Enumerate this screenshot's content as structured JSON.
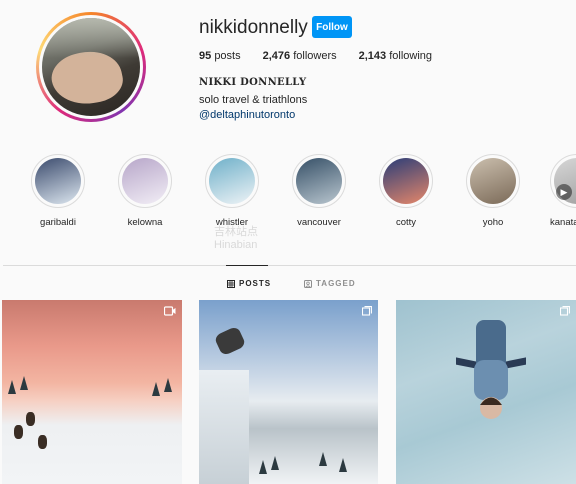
{
  "profile": {
    "username": "nikkidonnelly",
    "follow_label": "Follow",
    "stats": [
      {
        "count": "95",
        "label": "posts"
      },
      {
        "count": "2,476",
        "label": "followers"
      },
      {
        "count": "2,143",
        "label": "following"
      }
    ],
    "display_name": "NIKKI DONNELLY",
    "bio": "solo travel & triathlons",
    "link": "@deltaphinutoronto"
  },
  "highlights": [
    {
      "label": "garibaldi",
      "colors": [
        "#3b4b6d",
        "#dde7f0"
      ]
    },
    {
      "label": "kelowna",
      "colors": [
        "#b7a6c9",
        "#f2eef6"
      ]
    },
    {
      "label": "whistler",
      "colors": [
        "#6fb0c9",
        "#eef3f6"
      ]
    },
    {
      "label": "vancouver",
      "colors": [
        "#365067",
        "#b9c6cf"
      ]
    },
    {
      "label": "cotty",
      "colors": [
        "#2a3d78",
        "#e6876a"
      ]
    },
    {
      "label": "yoho",
      "colors": [
        "#cbbfae",
        "#7b6a58"
      ]
    },
    {
      "label": "kanata",
      "colors": [
        "#d7d7d7",
        "#9f9f9f"
      ]
    }
  ],
  "watermark": {
    "line1": "吉林站点",
    "line2": "Hinabian"
  },
  "tabs": [
    {
      "label": "POSTS",
      "active": true
    },
    {
      "label": "TAGGED",
      "active": false
    }
  ],
  "colors": {
    "accent": "#0095f6",
    "link": "#00376b",
    "text": "#262626",
    "muted": "#8e8e8e",
    "background": "#fafafa"
  }
}
